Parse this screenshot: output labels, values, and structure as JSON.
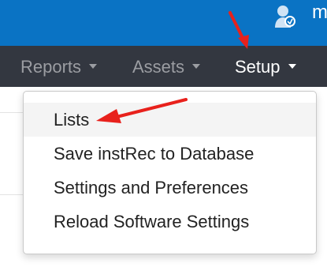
{
  "header": {
    "user_initial": "m",
    "user_icon": "user-avatar-icon",
    "bg_color": "#0a73c4"
  },
  "nav": {
    "bg_color": "#333740",
    "items": [
      {
        "label": "Reports",
        "active": false
      },
      {
        "label": "Assets",
        "active": false
      },
      {
        "label": "Setup",
        "active": true
      }
    ]
  },
  "dropdown": {
    "items": [
      {
        "label": "Lists",
        "highlighted": true
      },
      {
        "label": "Save instRec to Database",
        "highlighted": false
      },
      {
        "label": "Settings and Preferences",
        "highlighted": false
      },
      {
        "label": "Reload Software Settings",
        "highlighted": false
      }
    ]
  },
  "annotations": {
    "arrow_color": "#e8211c"
  }
}
